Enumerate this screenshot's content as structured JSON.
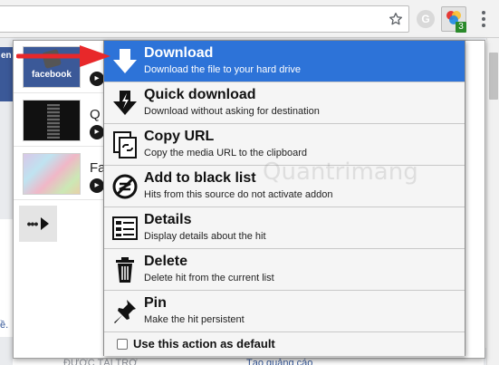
{
  "menu": {
    "items": [
      {
        "title": "Download",
        "desc": "Download the file to your hard drive",
        "selected": true
      },
      {
        "title": "Quick download",
        "desc": "Download without asking for destination",
        "selected": false
      },
      {
        "title": "Copy URL",
        "desc": "Copy the media URL to the clipboard",
        "selected": false
      },
      {
        "title": "Add to black list",
        "desc": "Hits from this source do not activate addon",
        "selected": false
      },
      {
        "title": "Details",
        "desc": "Display details about the hit",
        "selected": false
      },
      {
        "title": "Delete",
        "desc": "Delete hit from the current list",
        "selected": false
      },
      {
        "title": "Pin",
        "desc": "Make the hit persistent",
        "selected": false
      }
    ],
    "default_label": "Use this action as default",
    "default_checked": false,
    "selected_color": "#2d73d8"
  },
  "hits": [
    {
      "thumb_text": "facebook",
      "title_letter": ""
    },
    {
      "thumb_text": "",
      "title_letter": "Q"
    },
    {
      "thumb_text": "",
      "title_letter": "Fa"
    }
  ],
  "more_label": "•••",
  "extension": {
    "badge_count": "3",
    "g_label": "G"
  },
  "page": {
    "left_fragment": "en",
    "edge_fragment": "ề.",
    "footer_left": "ĐƯỢC TÀI TRỢ",
    "footer_right": "Tạo quảng cáo"
  },
  "watermark": "Quantrimang",
  "colors": {
    "accent": "#2d73d8",
    "annotation_arrow": "#e8282a",
    "facebook_blue": "#3b5998"
  }
}
